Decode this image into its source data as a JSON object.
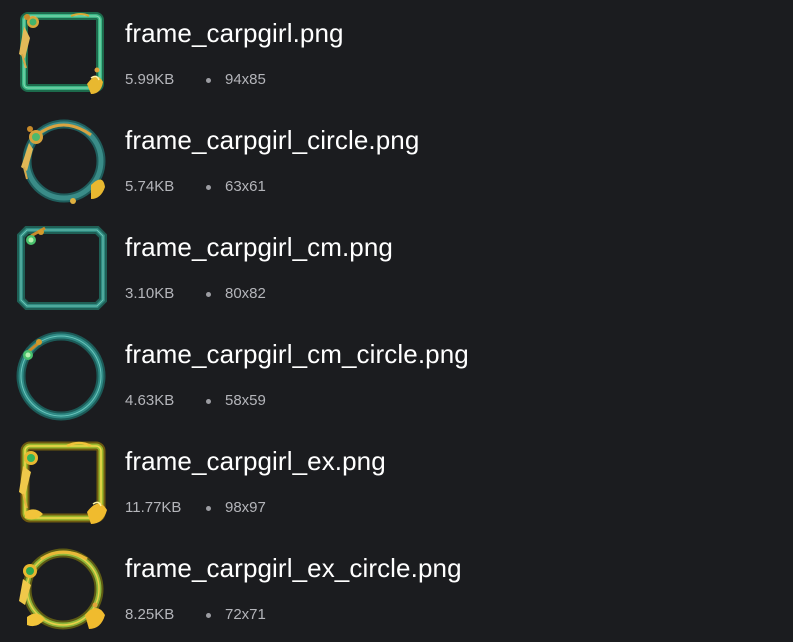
{
  "files": [
    {
      "name": "frame_carpgirl.png",
      "size": "5.99KB",
      "dimensions": "94x85",
      "thumbnail_icon": "square-jade-frame-icon"
    },
    {
      "name": "frame_carpgirl_circle.png",
      "size": "5.74KB",
      "dimensions": "63x61",
      "thumbnail_icon": "circle-jade-frame-icon"
    },
    {
      "name": "frame_carpgirl_cm.png",
      "size": "3.10KB",
      "dimensions": "80x82",
      "thumbnail_icon": "square-teal-frame-icon"
    },
    {
      "name": "frame_carpgirl_cm_circle.png",
      "size": "4.63KB",
      "dimensions": "58x59",
      "thumbnail_icon": "circle-teal-frame-icon"
    },
    {
      "name": "frame_carpgirl_ex.png",
      "size": "11.77KB",
      "dimensions": "98x97",
      "thumbnail_icon": "square-gold-frame-icon"
    },
    {
      "name": "frame_carpgirl_ex_circle.png",
      "size": "8.25KB",
      "dimensions": "72x71",
      "thumbnail_icon": "circle-gold-frame-icon"
    }
  ],
  "separator": "•",
  "colors": {
    "background": "#1b1c1f",
    "name_text": "#ffffff",
    "meta_text": "#b4b5ba",
    "jade_green": "#2e9e72",
    "teal": "#2f8a80",
    "gold": "#e8b830"
  }
}
